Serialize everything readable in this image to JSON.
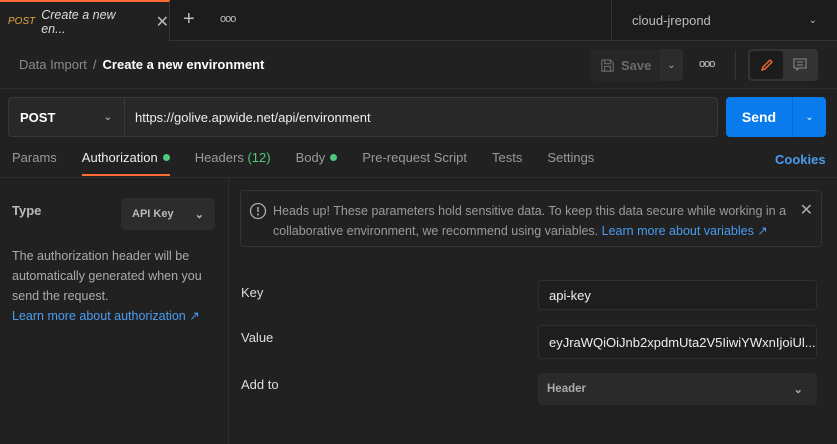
{
  "tab": {
    "method": "POST",
    "title": "Create a new en...",
    "new_tab": "+",
    "more": "ooo"
  },
  "workspace": {
    "name": "cloud-jrepond"
  },
  "breadcrumb": {
    "parent": "Data Import",
    "separator": "/",
    "current": "Create a new environment"
  },
  "toolbar": {
    "save_label": "Save",
    "more": "ooo"
  },
  "request": {
    "method": "POST",
    "url": "https://golive.apwide.net/api/environment",
    "send_label": "Send"
  },
  "tabs": [
    {
      "label": "Params"
    },
    {
      "label": "Authorization",
      "dot": true
    },
    {
      "label": "Headers",
      "count": "(12)"
    },
    {
      "label": "Body",
      "dot": true
    },
    {
      "label": "Pre-request Script"
    },
    {
      "label": "Tests"
    },
    {
      "label": "Settings"
    }
  ],
  "cookies_label": "Cookies",
  "auth": {
    "type_label": "Type",
    "type_value": "API Key",
    "description": "The authorization header will be automatically generated when you send the request.",
    "learn_link": "Learn more about authorization ↗"
  },
  "alert": {
    "text": "Heads up! These parameters hold sensitive data. To keep this data secure while working in a collaborative environment, we recommend using variables.",
    "link": "Learn more about variables ↗"
  },
  "fields": {
    "key_label": "Key",
    "key_value": "api-key",
    "value_label": "Value",
    "value_value": "eyJraWQiOiJnb2xpdmUta2V5IiwiYWxnIjoiUl...",
    "addto_label": "Add to",
    "addto_value": "Header"
  },
  "colors": {
    "accent": "#ff6c37",
    "send": "#097bed",
    "link": "#4a9cf0",
    "dot": "#4fc97c"
  }
}
